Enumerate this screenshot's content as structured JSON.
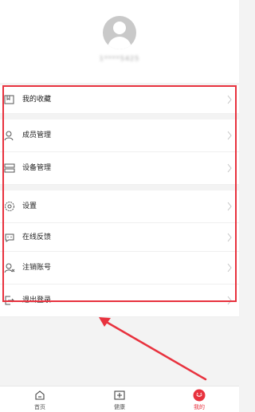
{
  "profile": {
    "username": "1****5425"
  },
  "menu": {
    "items": [
      {
        "label": "我的收藏",
        "icon": "favorites-icon"
      },
      {
        "label": "成员管理",
        "icon": "member-icon"
      },
      {
        "label": "设备管理",
        "icon": "device-icon"
      },
      {
        "label": "设置",
        "icon": "settings-icon"
      },
      {
        "label": "在线反馈",
        "icon": "feedback-icon"
      },
      {
        "label": "注销账号",
        "icon": "delete-account-icon"
      },
      {
        "label": "退出登录",
        "icon": "logout-icon"
      }
    ]
  },
  "tabbar": {
    "tabs": [
      {
        "label": "首页",
        "icon": "home-icon"
      },
      {
        "label": "健康",
        "icon": "health-icon"
      },
      {
        "label": "我的",
        "icon": "profile-icon",
        "active": true
      }
    ]
  },
  "colors": {
    "accent": "#e8323e",
    "background": "#f3f3f3"
  }
}
